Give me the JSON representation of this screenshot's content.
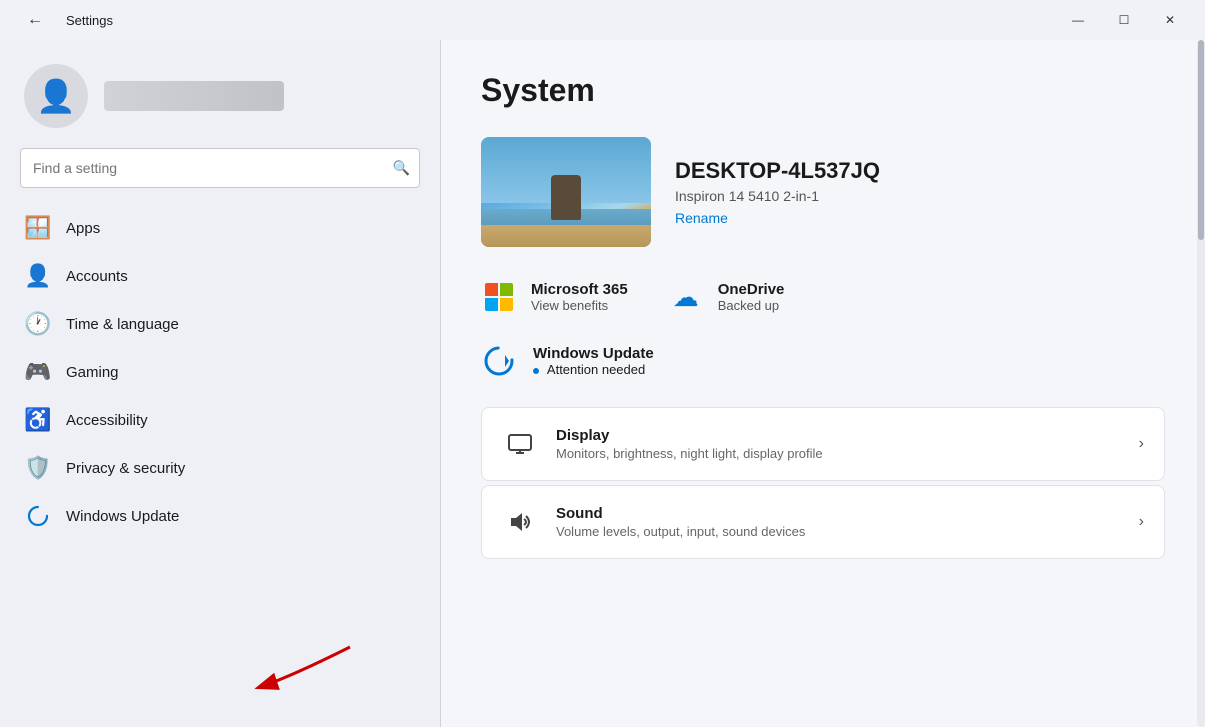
{
  "titlebar": {
    "title": "Settings",
    "min_label": "—",
    "max_label": "☐",
    "close_label": "✕"
  },
  "sidebar": {
    "search_placeholder": "Find a setting",
    "search_icon": "🔍",
    "profile": {
      "avatar_label": "user avatar"
    },
    "nav_items": [
      {
        "id": "apps",
        "label": "Apps",
        "icon": "🪟"
      },
      {
        "id": "accounts",
        "label": "Accounts",
        "icon": "👤"
      },
      {
        "id": "time-language",
        "label": "Time & language",
        "icon": "🕐"
      },
      {
        "id": "gaming",
        "label": "Gaming",
        "icon": "🎮"
      },
      {
        "id": "accessibility",
        "label": "Accessibility",
        "icon": "♿"
      },
      {
        "id": "privacy-security",
        "label": "Privacy & security",
        "icon": "🛡️"
      },
      {
        "id": "windows-update",
        "label": "Windows Update",
        "icon": "🔄"
      }
    ]
  },
  "main": {
    "page_title": "System",
    "device": {
      "name": "DESKTOP-4L537JQ",
      "model": "Inspiron 14 5410 2-in-1",
      "rename_label": "Rename"
    },
    "services": [
      {
        "id": "microsoft365",
        "name": "Microsoft 365",
        "sub": "View benefits",
        "icon_type": "ms365"
      },
      {
        "id": "onedrive",
        "name": "OneDrive",
        "sub": "Backed up",
        "icon_type": "onedrive"
      }
    ],
    "update": {
      "title": "Windows Update",
      "status": "Attention needed",
      "icon_type": "sync"
    },
    "settings": [
      {
        "id": "display",
        "title": "Display",
        "sub": "Monitors, brightness, night light, display profile",
        "icon": "🖥"
      },
      {
        "id": "sound",
        "title": "Sound",
        "sub": "Volume levels, output, input, sound devices",
        "icon": "🔊"
      }
    ]
  }
}
